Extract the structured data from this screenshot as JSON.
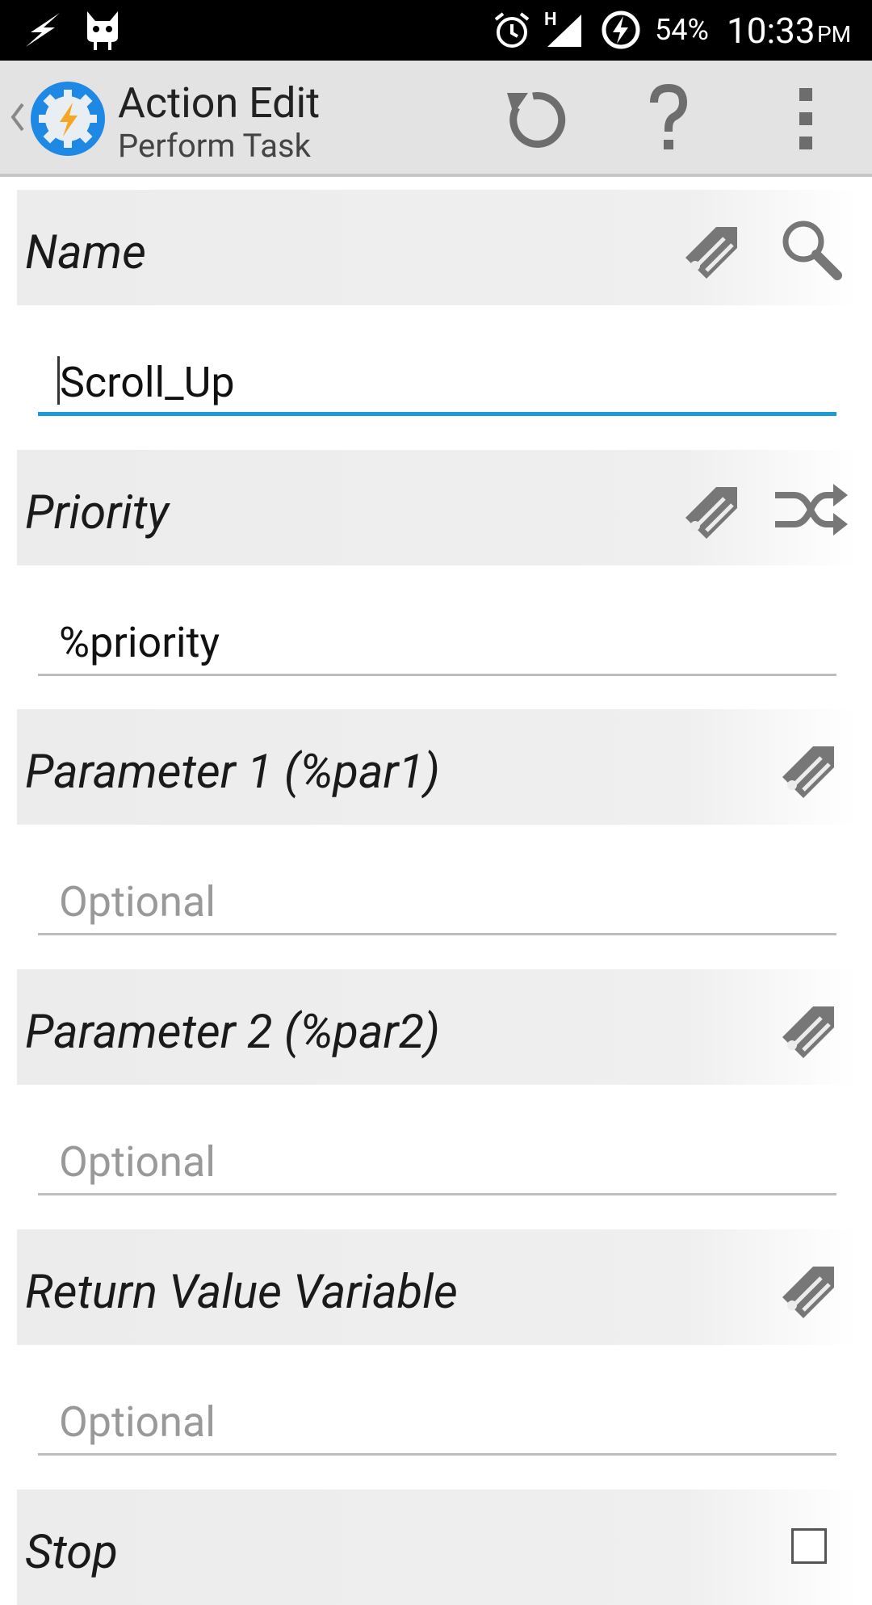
{
  "status_bar": {
    "battery_percent": "54%",
    "time": "10:33",
    "ampm": "PM",
    "network_type": "H",
    "icons": [
      "flash-icon",
      "cat-icon",
      "alarm-icon",
      "signal-icon",
      "charging-icon"
    ]
  },
  "action_bar": {
    "title": "Action Edit",
    "subtitle": "Perform Task",
    "app_icon": "tasker-gear-icon",
    "buttons": [
      "refresh-icon",
      "help-icon",
      "overflow-menu-icon"
    ]
  },
  "form": {
    "name_label": "Name",
    "name_value": "Scroll_Up",
    "priority_label": "Priority",
    "priority_value": "%priority",
    "param1_label": "Parameter 1 (%par1)",
    "param1_placeholder": "Optional",
    "param2_label": "Parameter 2 (%par2)",
    "param2_placeholder": "Optional",
    "return_label": "Return Value Variable",
    "return_placeholder": "Optional",
    "stop_label": "Stop"
  },
  "colors": {
    "focus_accent": "#1e9bd7",
    "app_icon_blue": "#1e88e5",
    "app_icon_orange": "#f5a623"
  }
}
